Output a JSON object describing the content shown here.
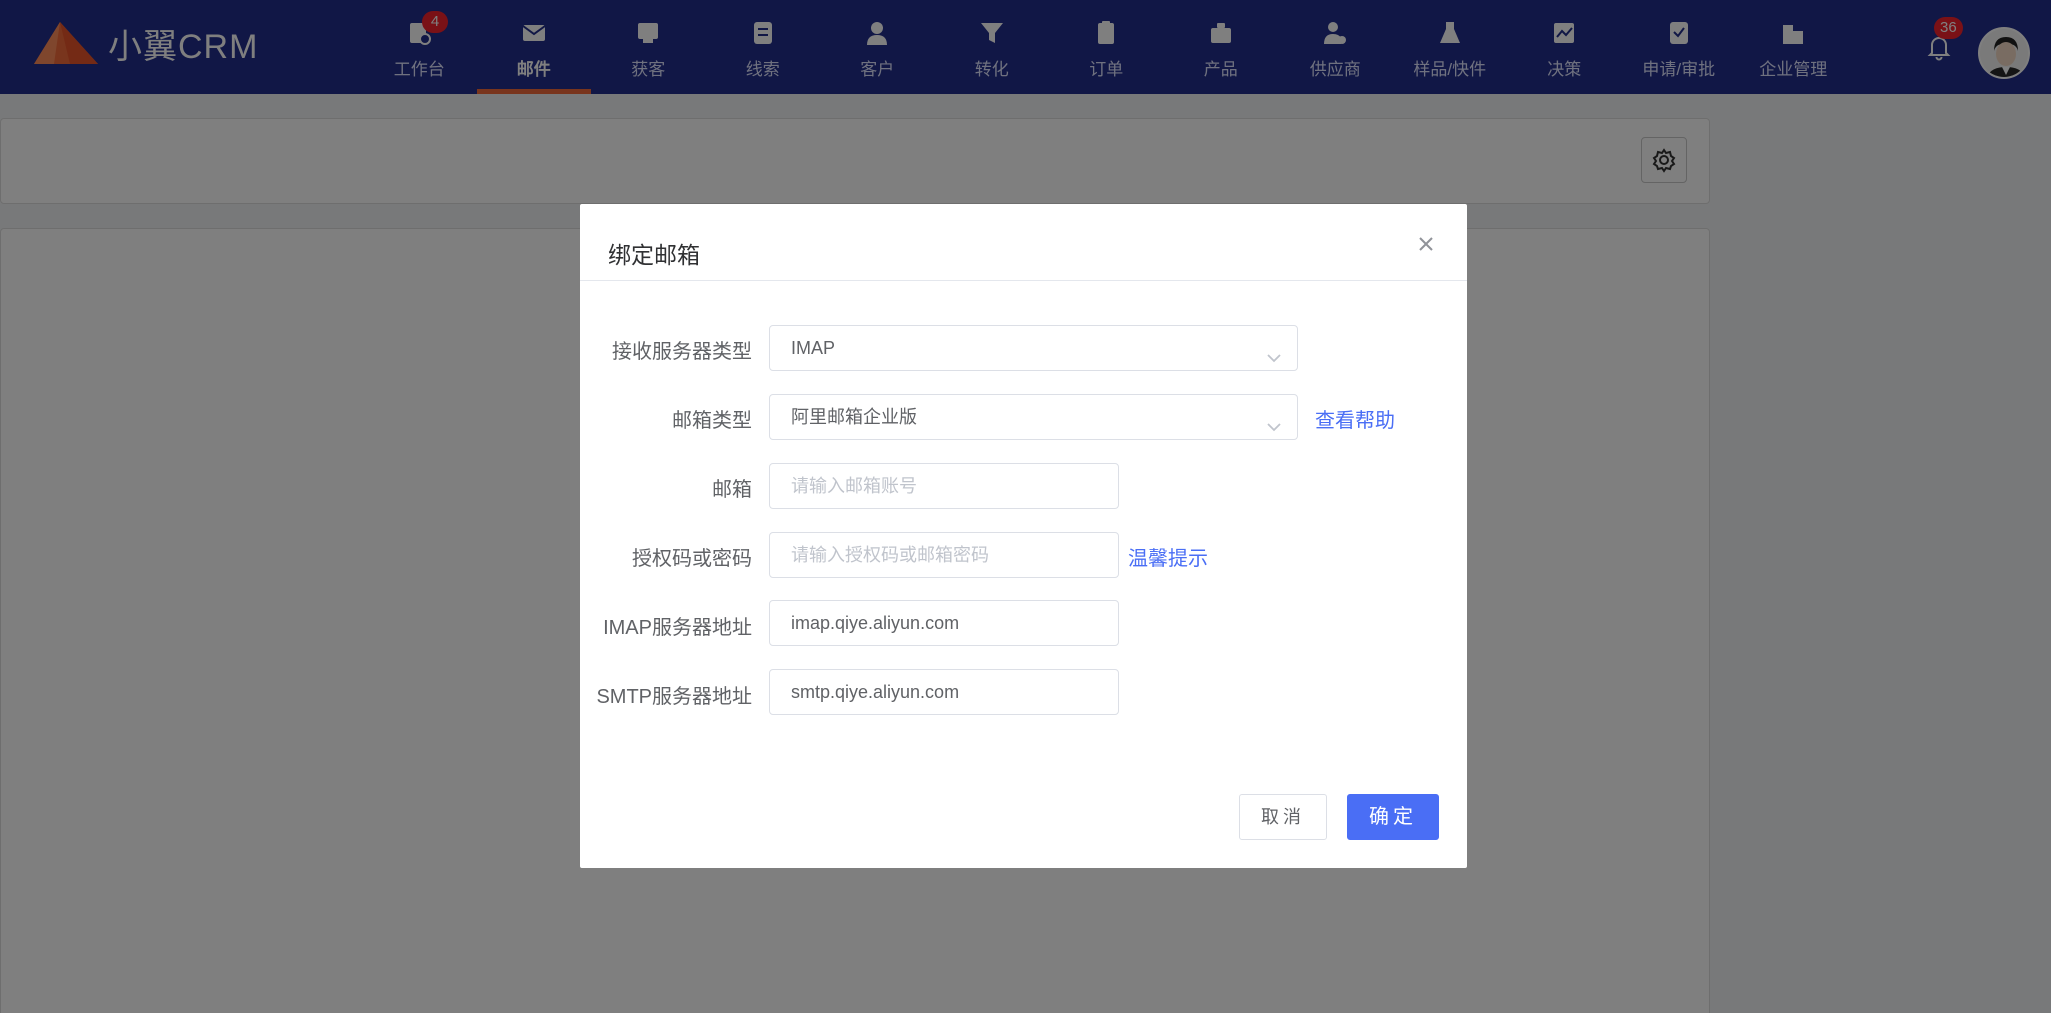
{
  "brand": {
    "name": "小翼CRM"
  },
  "colors": {
    "nav_bg": "#232e8c",
    "accent": "#f26b3a",
    "primary": "#4a6ef5",
    "badge": "#f5222d"
  },
  "nav": {
    "items": [
      {
        "label": "工作台",
        "icon": "workbench-icon",
        "badge": "4"
      },
      {
        "label": "邮件",
        "icon": "mail-icon",
        "active": true
      },
      {
        "label": "获客",
        "icon": "acquire-icon"
      },
      {
        "label": "线索",
        "icon": "leads-icon"
      },
      {
        "label": "客户",
        "icon": "customer-icon"
      },
      {
        "label": "转化",
        "icon": "funnel-icon"
      },
      {
        "label": "订单",
        "icon": "order-icon"
      },
      {
        "label": "产品",
        "icon": "product-icon"
      },
      {
        "label": "供应商",
        "icon": "supplier-icon"
      },
      {
        "label": "样品/快件",
        "icon": "sample-icon"
      },
      {
        "label": "决策",
        "icon": "decision-icon"
      },
      {
        "label": "申请/审批",
        "icon": "approval-icon"
      },
      {
        "label": "企业管理",
        "icon": "enterprise-icon"
      }
    ],
    "notifications_badge": "36"
  },
  "modal": {
    "title": "绑定邮箱",
    "fields": {
      "server_type": {
        "label": "接收服务器类型",
        "value": "IMAP"
      },
      "mail_type": {
        "label": "邮箱类型",
        "value": "阿里邮箱企业版",
        "help": "查看帮助"
      },
      "email": {
        "label": "邮箱",
        "placeholder": "请输入邮箱账号"
      },
      "password": {
        "label": "授权码或密码",
        "placeholder": "请输入授权码或邮箱密码",
        "hint": "温馨提示"
      },
      "imap": {
        "label": "IMAP服务器地址",
        "value": "imap.qiye.aliyun.com"
      },
      "smtp": {
        "label": "SMTP服务器地址",
        "value": "smtp.qiye.aliyun.com"
      }
    },
    "cancel_label": "取消",
    "ok_label": "确定"
  }
}
